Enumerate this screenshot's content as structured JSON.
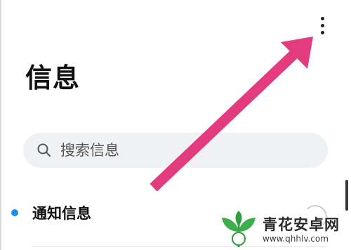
{
  "header": {
    "title": "信息",
    "more_icon": "more-vertical-icon"
  },
  "search": {
    "placeholder": "搜索信息",
    "icon": "search-icon"
  },
  "conversations": [
    {
      "label": "通知信息",
      "unread": true,
      "unread_color": "#1a8fe0"
    }
  ],
  "annotation": {
    "arrow_color": "#e23c7e",
    "points_to": "more-options-button"
  },
  "watermark": {
    "name": "青花安卓网",
    "url": "www.qhhlv.com"
  },
  "colors": {
    "search_bg": "#f0f1f3",
    "accent": "#1a8fe0"
  }
}
